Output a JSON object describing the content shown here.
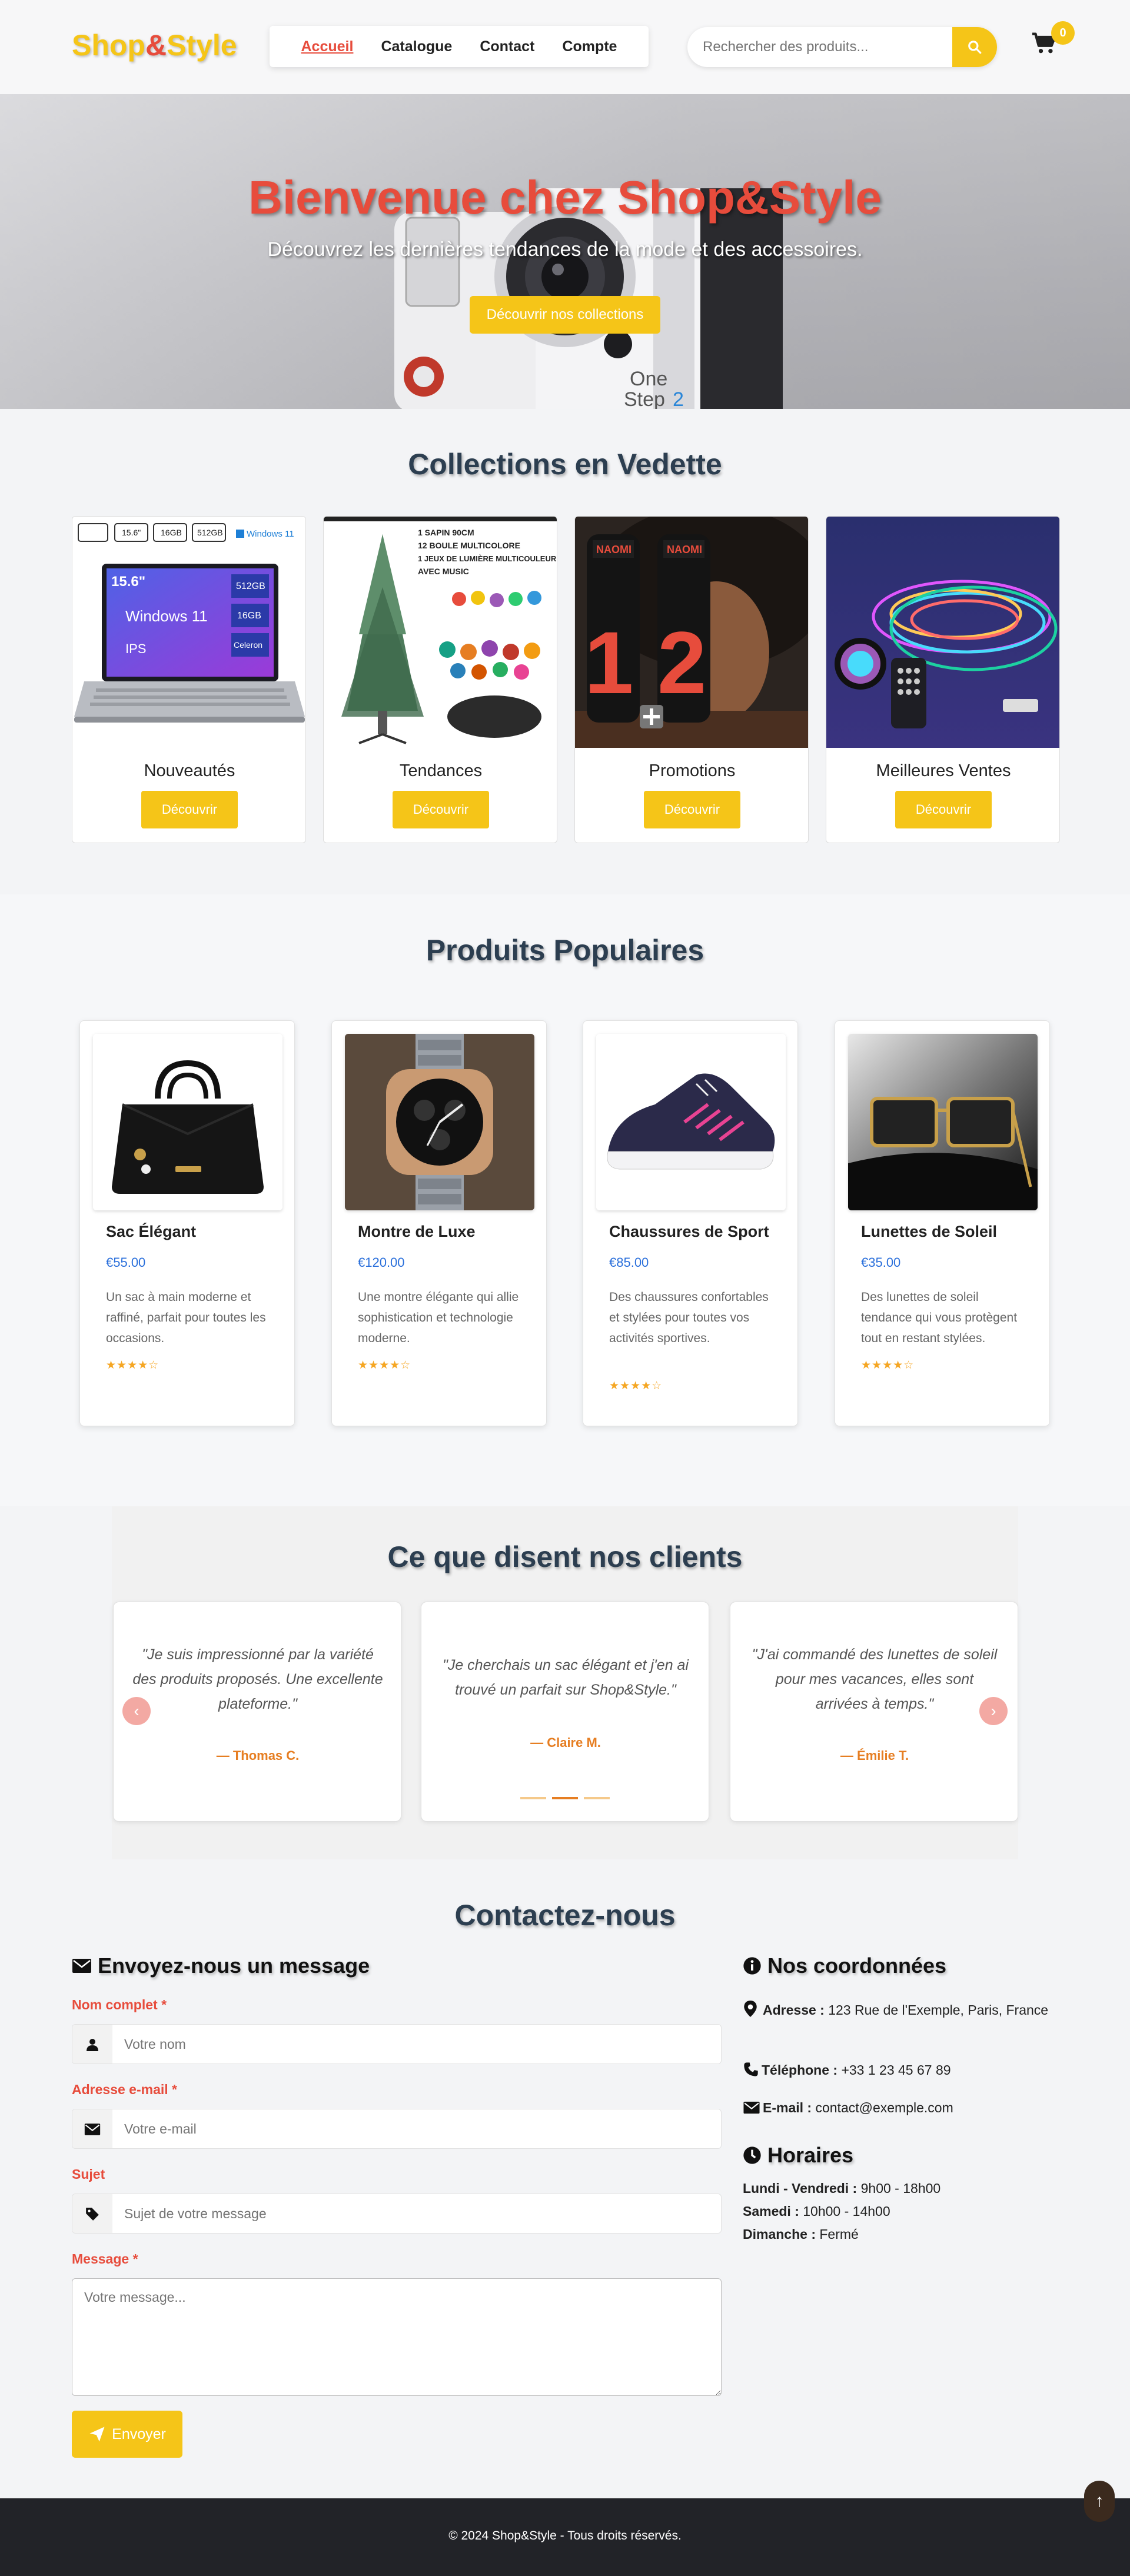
{
  "header": {
    "logo_main": "Shop",
    "logo_amp": "&",
    "logo_end": "Style",
    "nav": [
      {
        "label": "Accueil"
      },
      {
        "label": "Catalogue"
      },
      {
        "label": "Contact"
      },
      {
        "label": "Compte"
      }
    ],
    "search_placeholder": "Rechercher des produits...",
    "cart_count": "0"
  },
  "hero": {
    "title": "Bienvenue chez Shop&Style",
    "subtitle": "Découvrez les dernières tendances de la mode et des accessoires.",
    "button": "Découvrir nos collections"
  },
  "collections": {
    "title": "Collections en Vedette",
    "items": [
      {
        "name": "Nouveautés",
        "button": "Découvrir"
      },
      {
        "name": "Tendances",
        "button": "Découvrir"
      },
      {
        "name": "Promotions",
        "button": "Découvrir"
      },
      {
        "name": "Meilleures Ventes",
        "button": "Découvrir"
      }
    ],
    "laptop_labels": {
      "screen": "15.6\"",
      "os": "Windows 11",
      "panel": "IPS",
      "storage": "512GB",
      "ram": "16GB",
      "cpu": "Celeron",
      "badge_os": "Windows 11"
    },
    "tree_labels": [
      "1 SAPIN 90CM",
      "12 BOULE MULTICOLORE",
      "1 JEUX DE LUMIÈRE MULTICOULEUR",
      "AVEC MUSIC"
    ],
    "promo_labels": {
      "brand": "NAOMI",
      "one": "1",
      "two": "2"
    }
  },
  "products": {
    "title": "Produits Populaires",
    "items": [
      {
        "name": "Sac Élégant",
        "price": "€55.00",
        "description": "Un sac à main moderne et raffiné, parfait pour toutes les occasions.",
        "stars": "★★★★☆"
      },
      {
        "name": "Montre de Luxe",
        "price": "€120.00",
        "description": "Une montre élégante qui allie sophistication et technologie moderne.",
        "stars": "★★★★☆"
      },
      {
        "name": "Chaussures de Sport",
        "price": "€85.00",
        "description": "Des chaussures confortables et stylées pour toutes vos activités sportives.",
        "stars": "★★★★☆"
      },
      {
        "name": "Lunettes de Soleil",
        "price": "€35.00",
        "description": "Des lunettes de soleil tendance qui vous protègent tout en restant stylées.",
        "stars": "★★★★☆"
      }
    ]
  },
  "testimonials": {
    "title": "Ce que disent nos clients",
    "items": [
      {
        "quote": "\"Je suis impressionné par la variété des produits proposés. Une excellente plateforme.\"",
        "author": "— Thomas C."
      },
      {
        "quote": "\"Je cherchais un sac élégant et j'en ai trouvé un parfait sur Shop&Style.\"",
        "author": "— Claire M."
      },
      {
        "quote": "\"J'ai commandé des lunettes de soleil pour mes vacances, elles sont arrivées à temps.\"",
        "author": "— Émilie T."
      }
    ],
    "prev": "‹",
    "next": "›"
  },
  "contact": {
    "title": "Contactez-nous",
    "form_title": "Envoyez-nous un message",
    "name_label": "Nom complet",
    "name_placeholder": "Votre nom",
    "email_label": "Adresse e-mail",
    "email_placeholder": "Votre e-mail",
    "subject_label": "Sujet",
    "subject_placeholder": "Sujet de votre message",
    "message_label": "Message",
    "message_placeholder": "Votre message...",
    "required_mark": "*",
    "send": "Envoyer",
    "coords_title": "Nos coordonnées",
    "address_label": "Adresse :",
    "address": "123 Rue de l'Exemple, Paris, France",
    "phone_label": "Téléphone :",
    "phone": "+33 1 23 45 67 89",
    "email_info_label": "E-mail :",
    "email_info": "contact@exemple.com",
    "hours_title": "Horaires",
    "hours": [
      {
        "day": "Lundi - Vendredi :",
        "time": "9h00 - 18h00"
      },
      {
        "day": "Samedi :",
        "time": "10h00 - 14h00"
      },
      {
        "day": "Dimanche :",
        "time": "Fermé"
      }
    ]
  },
  "footer": {
    "text": "© 2024 Shop&Style - Tous droits réservés.",
    "back_to_top": "↑"
  },
  "colors": {
    "accent": "#f5c518",
    "brand_red": "#e74c3c",
    "price_blue": "#2a6fdb",
    "author_orange": "#e67e22",
    "footer": "#222328"
  }
}
